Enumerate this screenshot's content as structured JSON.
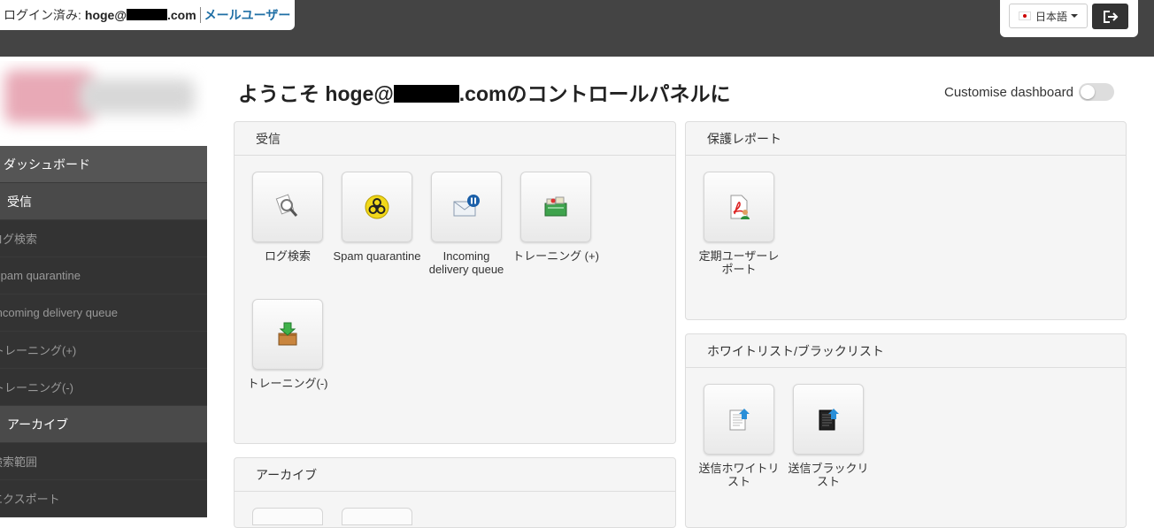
{
  "header": {
    "login_label": "ログイン済み:",
    "email_prefix": "hoge@",
    "email_suffix": ".com",
    "user_type": "メールユーザー",
    "language": "日本語"
  },
  "sidebar": {
    "items": [
      {
        "label": "ダッシュボード",
        "kind": "top"
      },
      {
        "label": "受信",
        "kind": "section"
      },
      {
        "label": "ログ検索",
        "kind": "sub"
      },
      {
        "label": "Spam quarantine",
        "kind": "sub"
      },
      {
        "label": "Incoming delivery queue",
        "kind": "sub"
      },
      {
        "label": "トレーニング(+)",
        "kind": "sub"
      },
      {
        "label": "トレーニング(-)",
        "kind": "sub"
      },
      {
        "label": "アーカイブ",
        "kind": "section"
      },
      {
        "label": "検索範囲",
        "kind": "sub"
      },
      {
        "label": "エクスポート",
        "kind": "sub"
      }
    ]
  },
  "main": {
    "title_prefix": "ようこそ hoge@",
    "title_suffix": ".comのコントロールパネルに",
    "customise_label": "Customise dashboard"
  },
  "panels": {
    "incoming": {
      "title": "受信",
      "tiles": [
        "ログ検索",
        "Spam quarantine",
        "Incoming delivery queue",
        "トレーニング (+)",
        "トレーニング(-)"
      ]
    },
    "reports": {
      "title": "保護レポート",
      "tiles": [
        "定期ユーザーレポート"
      ]
    },
    "lists": {
      "title": "ホワイトリスト/ブラックリスト",
      "tiles": [
        "送信ホワイトリスト",
        "送信ブラックリスト"
      ]
    },
    "archive": {
      "title": "アーカイブ"
    }
  },
  "icons": {
    "log-search": "magnifier-icon",
    "spam": "biohazard-icon",
    "queue": "mail-pause-icon",
    "train-plus": "money-box-icon",
    "train-minus": "download-box-icon",
    "report": "pdf-user-icon",
    "whitelist": "doc-upload-icon",
    "blacklist": "blackdoc-upload-icon"
  }
}
